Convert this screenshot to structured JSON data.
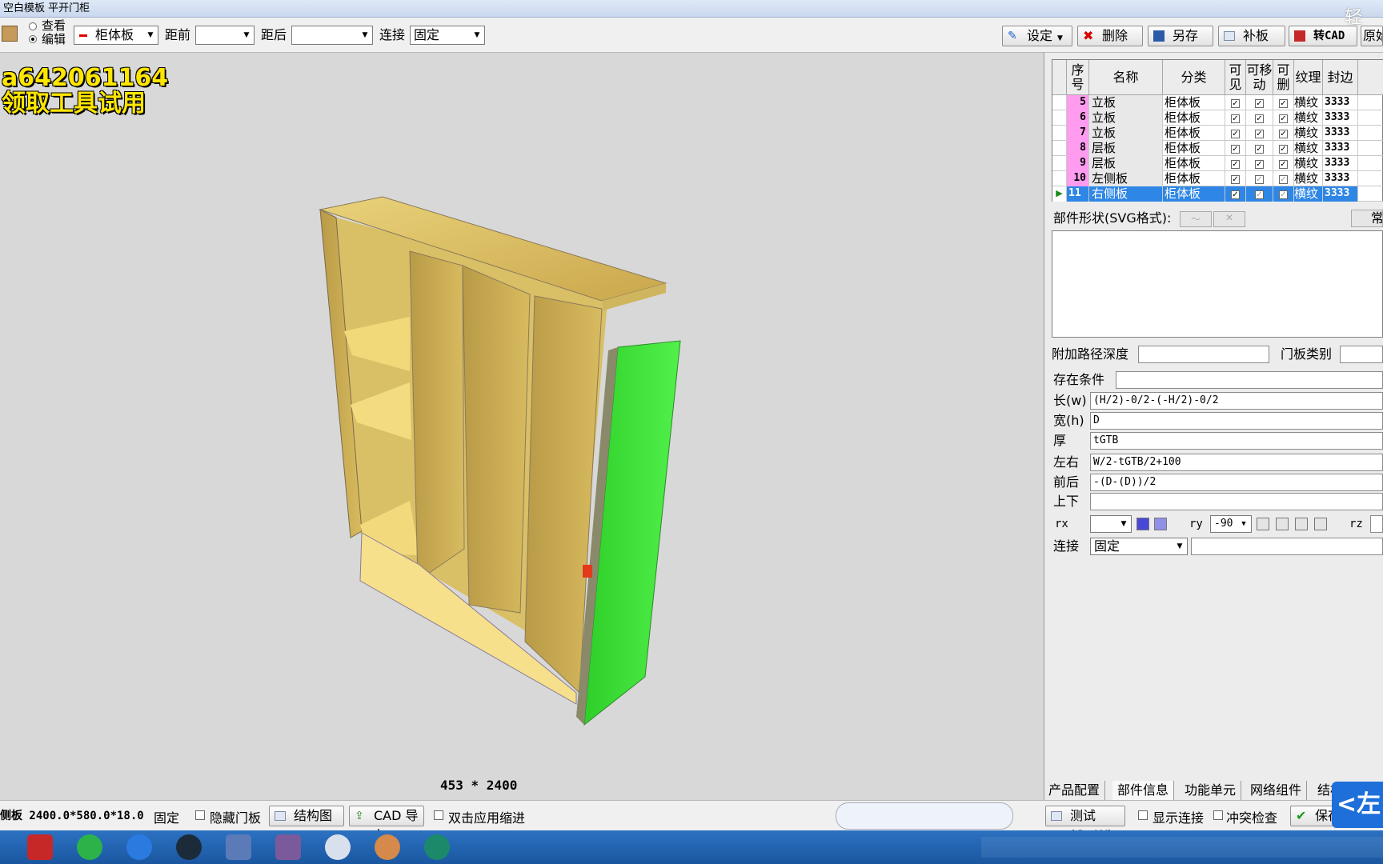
{
  "window": {
    "title": "空白模板 平开门柜"
  },
  "toolbar": {
    "mode_view": "查看",
    "mode_edit": "编辑",
    "board_type": "柜体板",
    "front_label": "距前",
    "front_value": "",
    "back_label": "距后",
    "back_value": "",
    "connect_label": "连接",
    "connect_value": "固定",
    "buttons": {
      "settings": "设定",
      "delete": "删除",
      "save_as": "另存",
      "patch": "补板",
      "to_cad": "转CAD",
      "original": "原始"
    }
  },
  "overlay": {
    "line1": "a642061164",
    "line2": "领取工具试用",
    "corner": "轻"
  },
  "viewport": {
    "dims": "453 * 2400"
  },
  "grid": {
    "headers": [
      "序号",
      "名称",
      "分类",
      "可见",
      "可移动",
      "可删",
      "纹理",
      "封边"
    ],
    "rows": [
      {
        "no": "5",
        "name": "立板",
        "category": "柜体板",
        "grain": "横纹",
        "edge": "3333"
      },
      {
        "no": "6",
        "name": "立板",
        "category": "柜体板",
        "grain": "横纹",
        "edge": "3333"
      },
      {
        "no": "7",
        "name": "立板",
        "category": "柜体板",
        "grain": "横纹",
        "edge": "3333"
      },
      {
        "no": "8",
        "name": "层板",
        "category": "柜体板",
        "grain": "横纹",
        "edge": "3333"
      },
      {
        "no": "9",
        "name": "层板",
        "category": "柜体板",
        "grain": "横纹",
        "edge": "3333"
      },
      {
        "no": "10",
        "name": "左侧板",
        "category": "柜体板",
        "grain": "横纹",
        "edge": "3333"
      },
      {
        "no": "11",
        "name": "右侧板",
        "category": "柜体板",
        "grain": "横纹",
        "edge": "3333"
      }
    ]
  },
  "props": {
    "shape_label": "部件形状(SVG格式):",
    "shape_side": "常",
    "path_depth_label": "附加路径深度",
    "path_depth_value": "",
    "door_type_label": "门板类别",
    "door_type_value": "",
    "exist_label": "存在条件",
    "exist_value": "",
    "length_label": "长(w)",
    "length_value": "(H/2)-0/2-(-H/2)-0/2",
    "width_label": "宽(h)",
    "width_value": "D",
    "thick_label": "厚",
    "thick_value": "tGTB",
    "lr_label": "左右",
    "lr_value": "W/2-tGTB/2+100",
    "fb_label": "前后",
    "fb_value": "-(D-(D))/2",
    "ud_label": "上下",
    "ud_value": "",
    "rx_label": "rx",
    "rx_value": "",
    "ry_label": "ry",
    "ry_value": "-90",
    "rz_label": "rz",
    "rz_value": "",
    "connect_label": "连接",
    "connect_value": "固定"
  },
  "tabs": [
    "产品配置",
    "部件信息",
    "功能单元",
    "网络组件",
    "结构图"
  ],
  "bottom": {
    "status": "侧板 2400.0*580.0*18.0",
    "fixed": "固定",
    "hide_door": "隐藏门板",
    "structure": "结构图",
    "cad_import": "CAD 导入",
    "dbl_click": "双击应用缩进",
    "test": "测试(C+W)",
    "show_conn": "显示连接",
    "conflict": "冲突检查",
    "save": "保存",
    "left_badge": "<左"
  },
  "colors": {
    "selection": "#2e86e6",
    "index_cell": "#ff9cf0",
    "panel_green": "#3ee63a",
    "wood": "#e2c76a"
  }
}
